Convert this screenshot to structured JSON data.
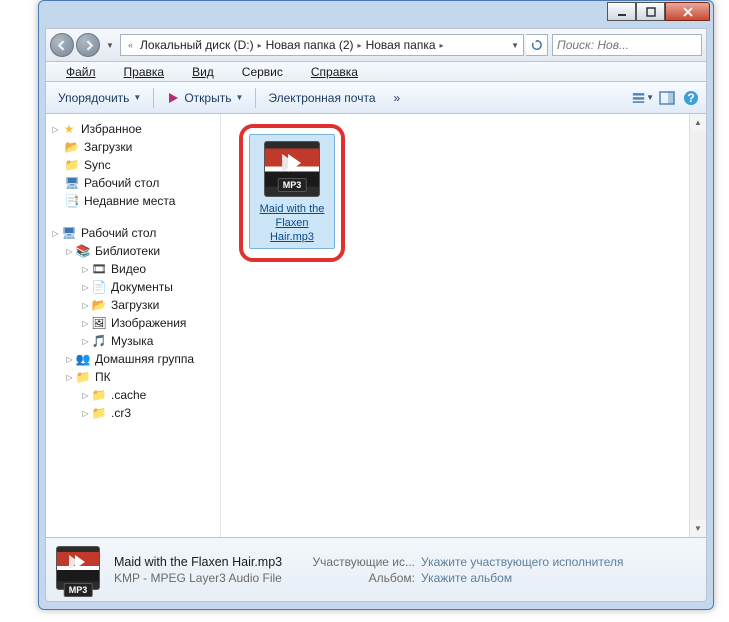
{
  "window": {
    "title": ""
  },
  "address": {
    "crumb_root_drop": "«",
    "crumb1": "Локальный диск (D:)",
    "crumb2": "Новая папка (2)",
    "crumb3": "Новая папка"
  },
  "search": {
    "placeholder": "Поиск: Нов..."
  },
  "menu": {
    "file": "Файл",
    "edit": "Правка",
    "view": "Вид",
    "tools": "Сервис",
    "help": "Справка"
  },
  "toolbar": {
    "organize": "Упорядочить",
    "open": "Открыть",
    "email": "Электронная почта",
    "more": "»"
  },
  "sidebar": {
    "favorites": "Избранное",
    "downloads": "Загрузки",
    "sync": "Sync",
    "desktop": "Рабочий стол",
    "recent": "Недавние места",
    "desktop2": "Рабочий стол",
    "libraries": "Библиотеки",
    "videos": "Видео",
    "documents": "Документы",
    "downloads2": "Загрузки",
    "pictures": "Изображения",
    "music": "Музыка",
    "homegroup": "Домашняя группа",
    "pc": "ПК",
    "cache": ".cache",
    "cr3": ".cr3"
  },
  "file": {
    "name": "Maid with the Flaxen Hair.mp3"
  },
  "details": {
    "filename": "Maid with the Flaxen Hair.mp3",
    "filetype": "KMP - MPEG Layer3 Audio File",
    "artists_label": "Участвующие ис...",
    "artists_value": "Укажите участвующего исполнителя",
    "album_label": "Альбом:",
    "album_value": "Укажите альбом"
  }
}
